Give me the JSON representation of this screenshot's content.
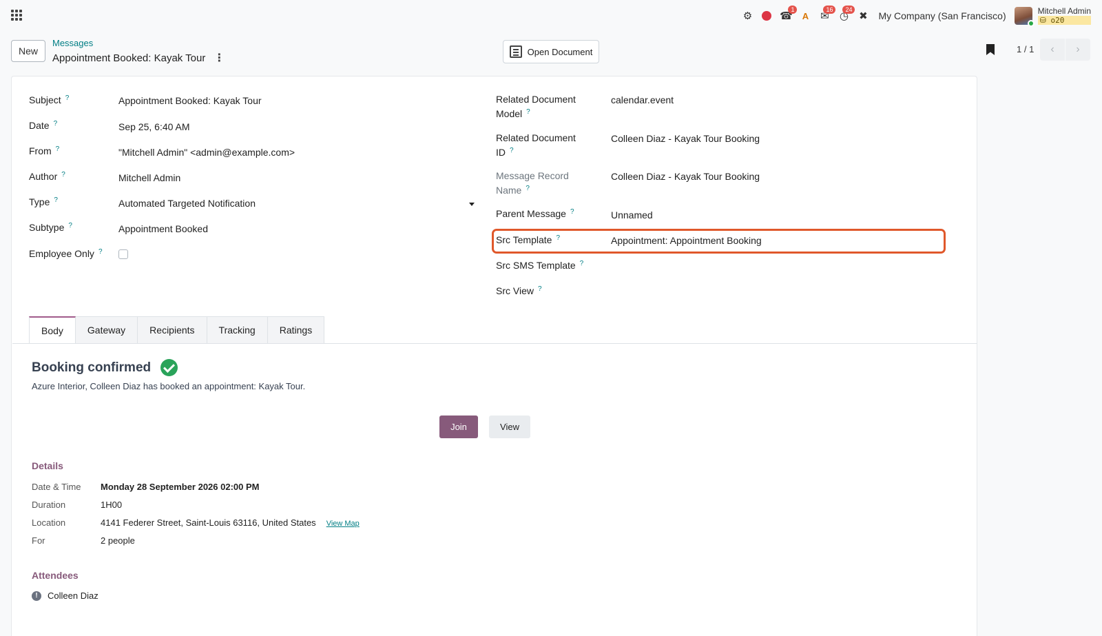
{
  "navbar": {
    "badges": {
      "phone": "1",
      "discuss": "16",
      "activity": "24"
    },
    "company": "My Company (San Francisco)",
    "user_name": "Mitchell Admin",
    "db_name": "o20"
  },
  "control": {
    "new_label": "New",
    "breadcrumb": "Messages",
    "record_title": "Appointment Booked: Kayak Tour",
    "open_document": "Open Document",
    "pager": "1 / 1"
  },
  "left_fields": [
    {
      "label": "Subject",
      "value": "Appointment Booked: Kayak Tour"
    },
    {
      "label": "Date",
      "value": "Sep 25, 6:40 AM"
    },
    {
      "label": "From",
      "value": "\"Mitchell Admin\" <admin@example.com>"
    },
    {
      "label": "Author",
      "value": "Mitchell Admin"
    },
    {
      "label": "Type",
      "value": "Automated Targeted Notification"
    },
    {
      "label": "Subtype",
      "value": "Appointment Booked"
    },
    {
      "label": "Employee Only",
      "value": ""
    }
  ],
  "right_fields": [
    {
      "label_1": "Related Document",
      "label_2": "Model",
      "value": "calendar.event"
    },
    {
      "label_1": "Related Document",
      "label_2": "ID",
      "value": "Colleen Diaz - Kayak Tour Booking"
    },
    {
      "label_1": "Message Record",
      "label_2": "Name",
      "value": "Colleen Diaz - Kayak Tour Booking"
    },
    {
      "label": "Parent Message",
      "value": "Unnamed"
    },
    {
      "label": "Src Template",
      "value": "Appointment: Appointment Booking"
    },
    {
      "label": "Src SMS Template",
      "value": ""
    },
    {
      "label": "Src View",
      "value": ""
    }
  ],
  "help_mark": "?",
  "tabs": [
    "Body",
    "Gateway",
    "Recipients",
    "Tracking",
    "Ratings"
  ],
  "body": {
    "title": "Booking confirmed",
    "text": "Azure Interior, Colleen Diaz has booked an appointment: Kayak Tour.",
    "join": "Join",
    "view": "View",
    "details_title": "Details",
    "details": [
      {
        "label": "Date & Time",
        "value": "Monday 28 September 2026 02:00 PM"
      },
      {
        "label": "Duration",
        "value": "1H00"
      },
      {
        "label": "Location",
        "value": "4141 Federer Street, Saint-Louis 63116, United States"
      },
      {
        "label": "For",
        "value": "2 people"
      }
    ],
    "view_map": "View Map",
    "attendees_title": "Attendees",
    "attendee": "Colleen Diaz",
    "attendee_status": "!"
  },
  "colors": {
    "accent": "#875a7b",
    "link": "#017e84",
    "highlight": "#e0582b",
    "success": "#2aa35a"
  }
}
